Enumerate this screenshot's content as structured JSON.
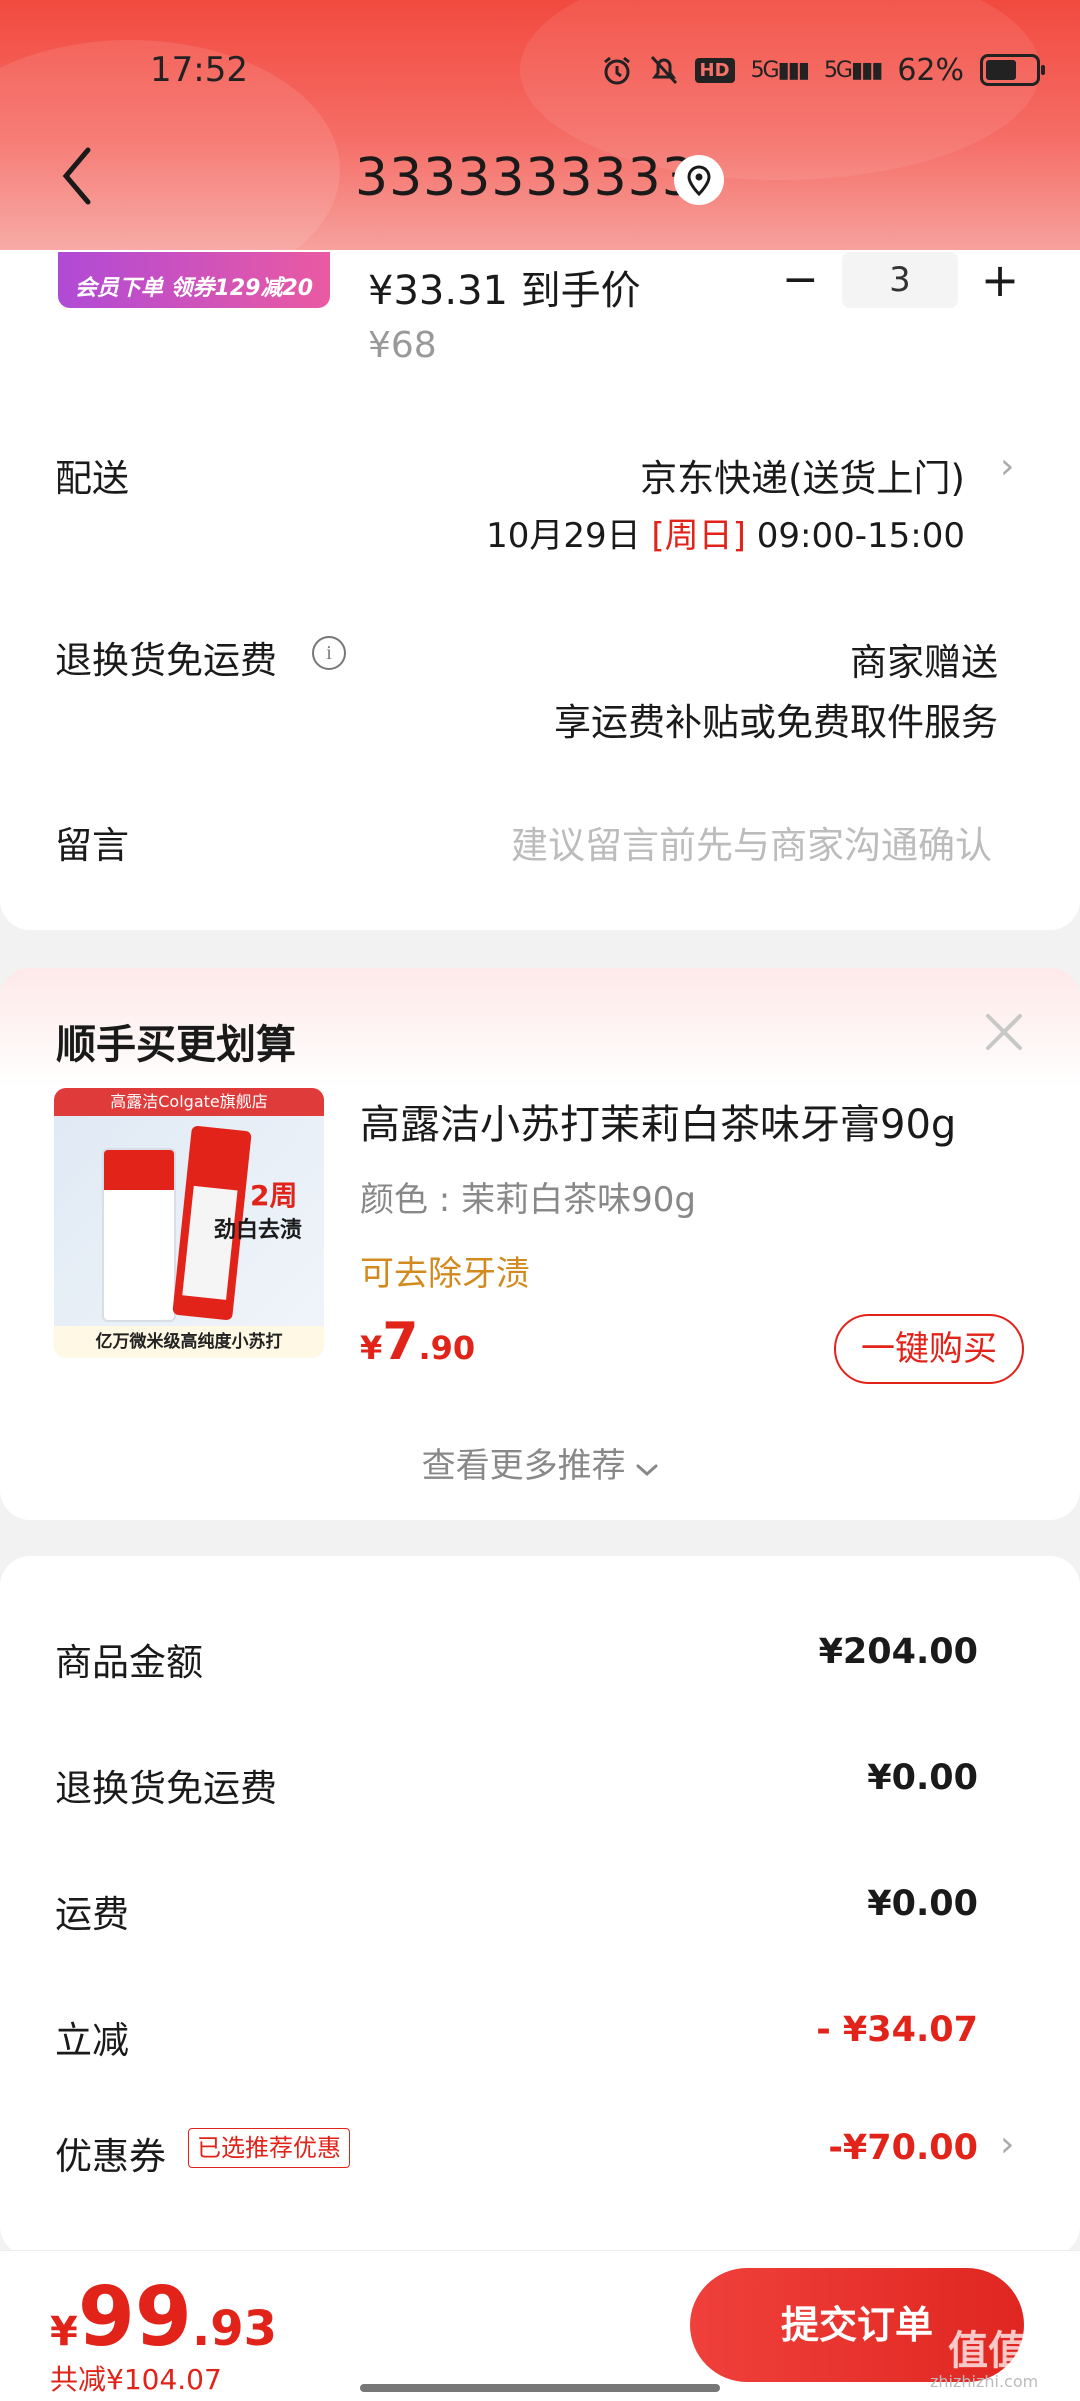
{
  "status": {
    "time": "17:52",
    "battery": "62%",
    "hd": "HD",
    "signal1": "5G",
    "signal2": "5G"
  },
  "nav": {
    "title": "3333333333"
  },
  "product": {
    "promo_badge": "会员下单 领券129减20",
    "price_now": "¥33.31 到手价",
    "price_old": "¥68",
    "quantity": "3"
  },
  "delivery": {
    "label": "配送",
    "method": "京东快递(送货上门)",
    "date": "10月29日",
    "weekday": "[周日]",
    "time": "09:00-15:00"
  },
  "return_shipping": {
    "label": "退换货免运费",
    "line1": "商家赠送",
    "line2": "享运费补贴或免费取件服务"
  },
  "message": {
    "label": "留言",
    "placeholder": "建议留言前先与商家沟通确认"
  },
  "recommend": {
    "title": "顺手买更划算",
    "item": {
      "image_brand": "高露洁Colgate旗舰店",
      "image_badge": "2周",
      "image_claim": "劲白去渍",
      "image_footer": "亿万微米级高纯度小苏打",
      "name": "高露洁小苏打茉莉白茶味牙膏90g",
      "spec": "颜色 : 茉莉白茶味90g",
      "tag": "可去除牙渍",
      "price_symbol": "¥",
      "price_int": "7",
      "price_dec": ".90",
      "buy_label": "一键购买"
    },
    "more_label": "查看更多推荐"
  },
  "summary": {
    "rows": [
      {
        "label": "商品金额",
        "value": "¥204.00"
      },
      {
        "label": "退换货免运费",
        "value": "¥0.00"
      },
      {
        "label": "运费",
        "value": "¥0.00"
      },
      {
        "label": "立减",
        "value": "- ¥34.07"
      },
      {
        "label": "优惠券",
        "value": "-¥70.00",
        "tag": "已选推荐优惠"
      }
    ]
  },
  "footer": {
    "total_symbol": "¥",
    "total_int": "99",
    "total_dec": ".93",
    "saved": "共减¥104.07",
    "submit_label": "提交订单",
    "watermark": "值值值",
    "watermark_sub": "zhizhizhi.com"
  },
  "colors": {
    "accent": "#e2231a",
    "header_top": "#f24a3f"
  }
}
